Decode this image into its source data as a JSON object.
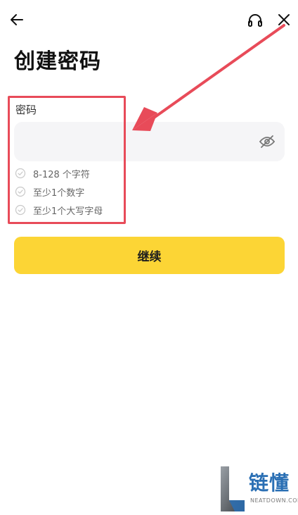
{
  "header": {
    "back_icon": "arrow-left-icon",
    "support_icon": "headset-icon",
    "close_icon": "close-icon"
  },
  "page": {
    "title": "创建密码"
  },
  "password": {
    "label": "密码",
    "value": "",
    "placeholder": "",
    "visibility_icon": "eye-off-icon"
  },
  "requirements": [
    {
      "text": "8-128 个字符",
      "icon": "check-circle-icon"
    },
    {
      "text": "至少1个数字",
      "icon": "check-circle-icon"
    },
    {
      "text": "至少1个大写字母",
      "icon": "check-circle-icon"
    }
  ],
  "actions": {
    "continue_label": "继续"
  },
  "colors": {
    "accent": "#fcd535",
    "annotation": "#e84b59",
    "input_bg": "#f5f5f7",
    "watermark": "#2a6fb4"
  },
  "watermark": {
    "text": "链懂",
    "sub": "NEATDOWN.COM"
  }
}
